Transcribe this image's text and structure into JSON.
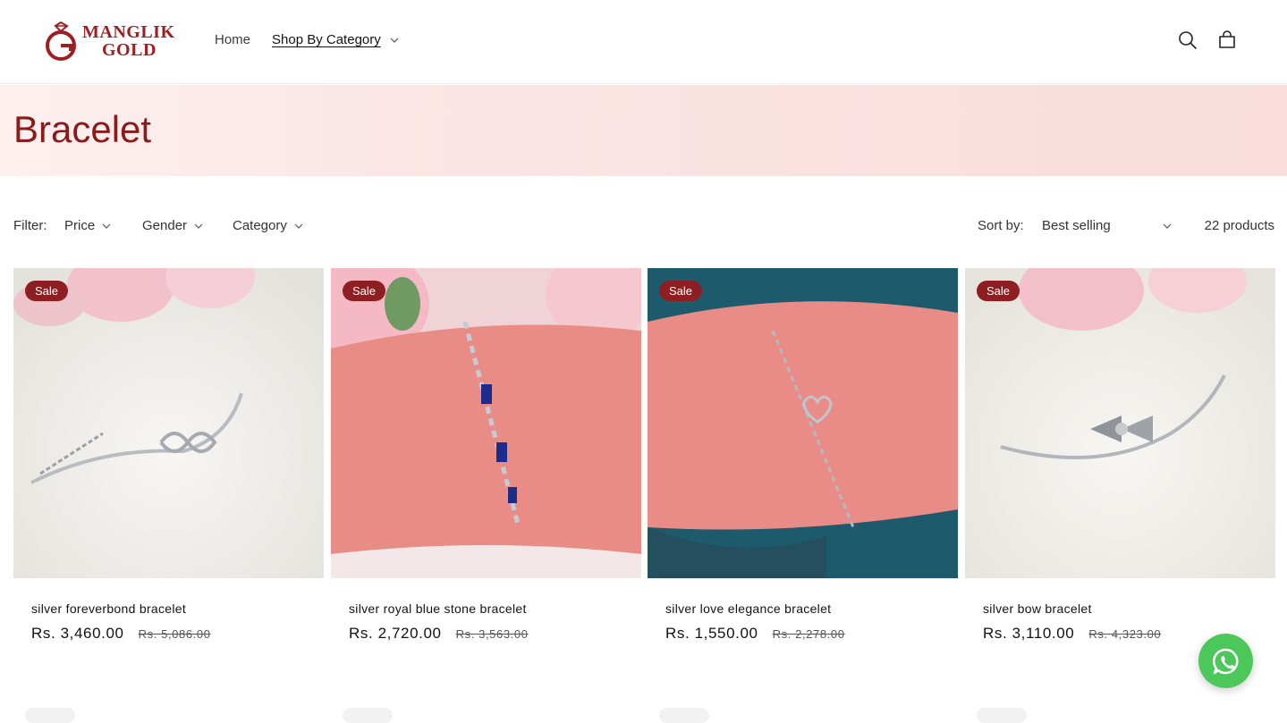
{
  "brand": {
    "line1": "MANGLIK",
    "line2": "GOLD",
    "color": "#9c1f23"
  },
  "nav": {
    "home": "Home",
    "shop_by_category": "Shop By Category"
  },
  "header_icons": {
    "search": "search-icon",
    "cart": "cart-icon"
  },
  "page": {
    "title": "Bracelet"
  },
  "filters": {
    "label": "Filter:",
    "price": "Price",
    "gender": "Gender",
    "category": "Category",
    "sort_label": "Sort by:",
    "sort_value": "Best selling",
    "product_count": "22 products"
  },
  "products": [
    {
      "badge": "Sale",
      "title": "silver foreverbond bracelet",
      "price": "Rs. 3,460.00",
      "compare_price": "Rs. 5,086.00"
    },
    {
      "badge": "Sale",
      "title": "silver royal blue stone bracelet",
      "price": "Rs. 2,720.00",
      "compare_price": "Rs. 3,563.00"
    },
    {
      "badge": "Sale",
      "title": "silver love elegance bracelet",
      "price": "Rs. 1,550.00",
      "compare_price": "Rs. 2,278.00"
    },
    {
      "badge": "Sale",
      "title": "silver bow bracelet",
      "price": "Rs. 3,110.00",
      "compare_price": "Rs. 4,323.00"
    }
  ],
  "colors": {
    "accent": "#8d1f22",
    "whatsapp": "#4cc75a"
  },
  "floating": {
    "whatsapp": "whatsapp-icon"
  }
}
